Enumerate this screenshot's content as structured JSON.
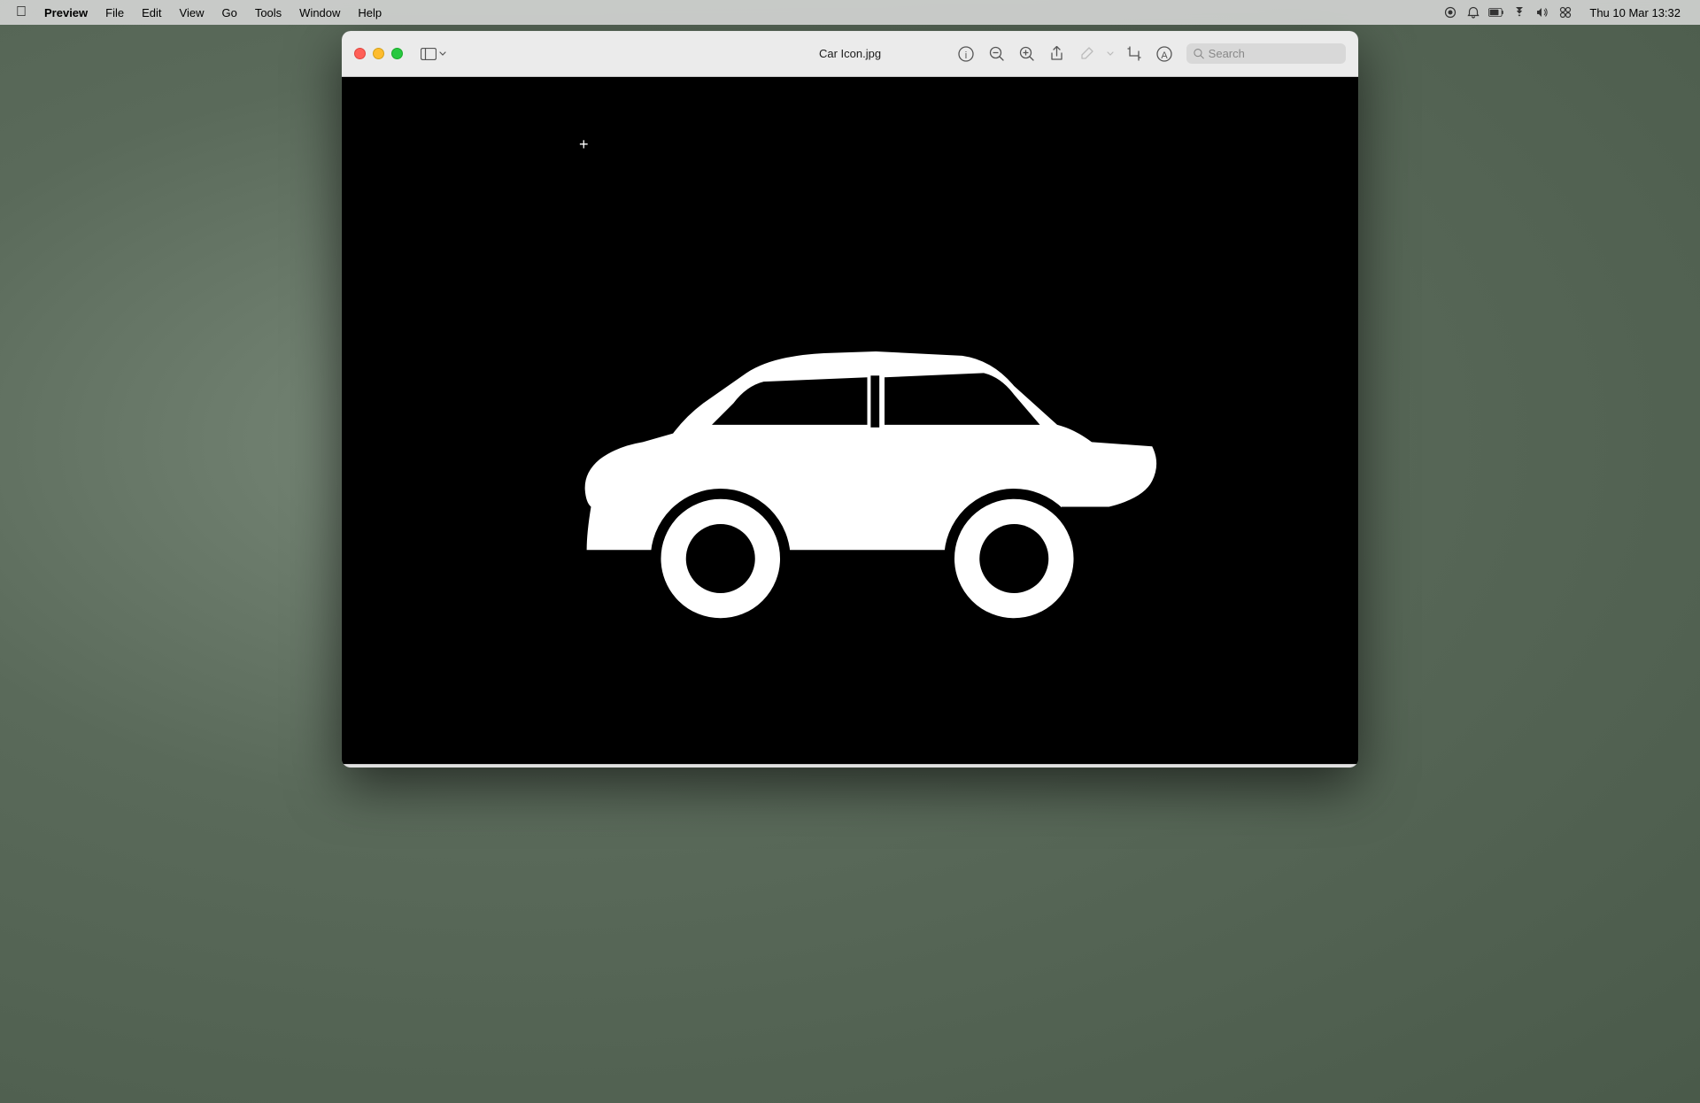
{
  "menubar": {
    "apple_label": "",
    "items": [
      "Preview",
      "File",
      "Edit",
      "View",
      "Go",
      "Tools",
      "Window",
      "Help"
    ],
    "right": {
      "datetime": "Thu 10 Mar  13:32"
    }
  },
  "window": {
    "title": "Car Icon.jpg",
    "toolbar": {
      "info_tooltip": "Info",
      "zoom_out_tooltip": "Zoom Out",
      "zoom_in_tooltip": "Zoom In",
      "share_tooltip": "Share",
      "markup_tooltip": "Markup",
      "crop_tooltip": "Crop",
      "annotate_tooltip": "Annotate"
    },
    "search": {
      "placeholder": "Search"
    }
  }
}
